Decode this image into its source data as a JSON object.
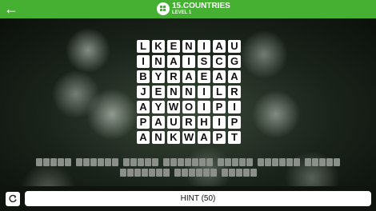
{
  "header": {
    "title": "15.COUNTRIES",
    "subtitle": "LEVEL 1",
    "back_icon": "arrow-left-icon",
    "logo_icon": "app-logo-icon"
  },
  "grid": {
    "rows": [
      [
        "L",
        "K",
        "E",
        "N",
        "I",
        "A",
        "U"
      ],
      [
        "I",
        "N",
        "A",
        "I",
        "S",
        "C",
        "G"
      ],
      [
        "B",
        "Y",
        "R",
        "A",
        "E",
        "A",
        "A"
      ],
      [
        "J",
        "E",
        "N",
        "N",
        "I",
        "L",
        "R"
      ],
      [
        "A",
        "Y",
        "W",
        "O",
        "I",
        "P",
        "I"
      ],
      [
        "P",
        "A",
        "U",
        "R",
        "H",
        "I",
        "P"
      ],
      [
        "A",
        "N",
        "K",
        "W",
        "A",
        "P",
        "T"
      ]
    ]
  },
  "answers": {
    "word_lengths": [
      5,
      6,
      5,
      7,
      5,
      6,
      5,
      7,
      6,
      5
    ]
  },
  "footer": {
    "refresh_icon": "refresh-icon",
    "hint_label": "HINT (50)"
  },
  "colors": {
    "accent": "#46b033",
    "slot": "#8a8f8a"
  }
}
